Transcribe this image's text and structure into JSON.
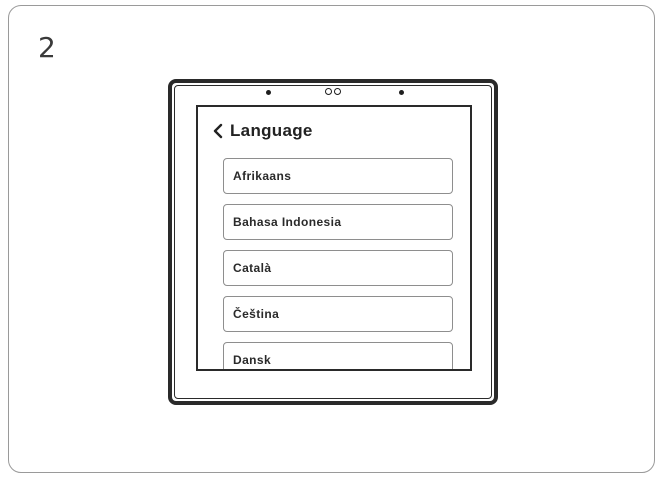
{
  "step": {
    "number": "2"
  },
  "screen": {
    "title": "Language",
    "back_icon": "chevron-left-icon",
    "languages": [
      {
        "label": "Afrikaans"
      },
      {
        "label": "Bahasa Indonesia"
      },
      {
        "label": "Català"
      },
      {
        "label": "Čeština"
      },
      {
        "label": "Dansk"
      }
    ]
  },
  "colors": {
    "outline": "#2a2a2a",
    "card_border": "#9a9a9a",
    "item_border": "#8e8e8e",
    "text": "#222222"
  }
}
